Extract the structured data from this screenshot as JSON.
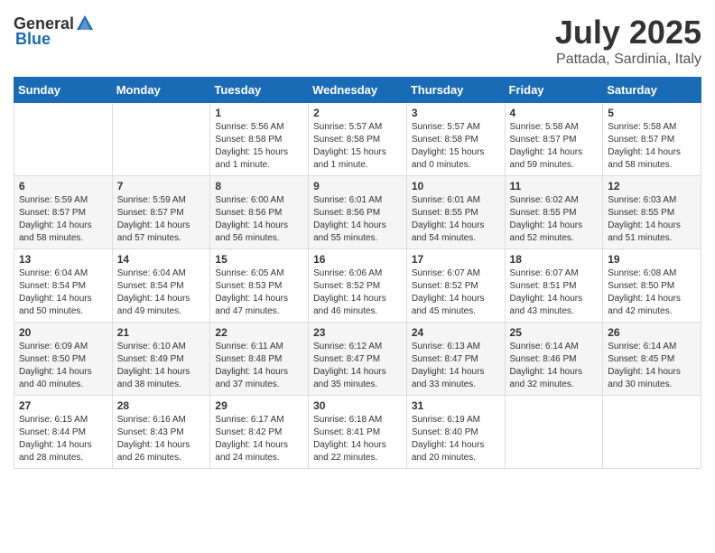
{
  "header": {
    "logo_general": "General",
    "logo_blue": "Blue",
    "title": "July 2025",
    "location": "Pattada, Sardinia, Italy"
  },
  "weekdays": [
    "Sunday",
    "Monday",
    "Tuesday",
    "Wednesday",
    "Thursday",
    "Friday",
    "Saturday"
  ],
  "weeks": [
    [
      {
        "day": "",
        "sunrise": "",
        "sunset": "",
        "daylight": ""
      },
      {
        "day": "",
        "sunrise": "",
        "sunset": "",
        "daylight": ""
      },
      {
        "day": "1",
        "sunrise": "Sunrise: 5:56 AM",
        "sunset": "Sunset: 8:58 PM",
        "daylight": "Daylight: 15 hours and 1 minute."
      },
      {
        "day": "2",
        "sunrise": "Sunrise: 5:57 AM",
        "sunset": "Sunset: 8:58 PM",
        "daylight": "Daylight: 15 hours and 1 minute."
      },
      {
        "day": "3",
        "sunrise": "Sunrise: 5:57 AM",
        "sunset": "Sunset: 8:58 PM",
        "daylight": "Daylight: 15 hours and 0 minutes."
      },
      {
        "day": "4",
        "sunrise": "Sunrise: 5:58 AM",
        "sunset": "Sunset: 8:57 PM",
        "daylight": "Daylight: 14 hours and 59 minutes."
      },
      {
        "day": "5",
        "sunrise": "Sunrise: 5:58 AM",
        "sunset": "Sunset: 8:57 PM",
        "daylight": "Daylight: 14 hours and 58 minutes."
      }
    ],
    [
      {
        "day": "6",
        "sunrise": "Sunrise: 5:59 AM",
        "sunset": "Sunset: 8:57 PM",
        "daylight": "Daylight: 14 hours and 58 minutes."
      },
      {
        "day": "7",
        "sunrise": "Sunrise: 5:59 AM",
        "sunset": "Sunset: 8:57 PM",
        "daylight": "Daylight: 14 hours and 57 minutes."
      },
      {
        "day": "8",
        "sunrise": "Sunrise: 6:00 AM",
        "sunset": "Sunset: 8:56 PM",
        "daylight": "Daylight: 14 hours and 56 minutes."
      },
      {
        "day": "9",
        "sunrise": "Sunrise: 6:01 AM",
        "sunset": "Sunset: 8:56 PM",
        "daylight": "Daylight: 14 hours and 55 minutes."
      },
      {
        "day": "10",
        "sunrise": "Sunrise: 6:01 AM",
        "sunset": "Sunset: 8:55 PM",
        "daylight": "Daylight: 14 hours and 54 minutes."
      },
      {
        "day": "11",
        "sunrise": "Sunrise: 6:02 AM",
        "sunset": "Sunset: 8:55 PM",
        "daylight": "Daylight: 14 hours and 52 minutes."
      },
      {
        "day": "12",
        "sunrise": "Sunrise: 6:03 AM",
        "sunset": "Sunset: 8:55 PM",
        "daylight": "Daylight: 14 hours and 51 minutes."
      }
    ],
    [
      {
        "day": "13",
        "sunrise": "Sunrise: 6:04 AM",
        "sunset": "Sunset: 8:54 PM",
        "daylight": "Daylight: 14 hours and 50 minutes."
      },
      {
        "day": "14",
        "sunrise": "Sunrise: 6:04 AM",
        "sunset": "Sunset: 8:54 PM",
        "daylight": "Daylight: 14 hours and 49 minutes."
      },
      {
        "day": "15",
        "sunrise": "Sunrise: 6:05 AM",
        "sunset": "Sunset: 8:53 PM",
        "daylight": "Daylight: 14 hours and 47 minutes."
      },
      {
        "day": "16",
        "sunrise": "Sunrise: 6:06 AM",
        "sunset": "Sunset: 8:52 PM",
        "daylight": "Daylight: 14 hours and 46 minutes."
      },
      {
        "day": "17",
        "sunrise": "Sunrise: 6:07 AM",
        "sunset": "Sunset: 8:52 PM",
        "daylight": "Daylight: 14 hours and 45 minutes."
      },
      {
        "day": "18",
        "sunrise": "Sunrise: 6:07 AM",
        "sunset": "Sunset: 8:51 PM",
        "daylight": "Daylight: 14 hours and 43 minutes."
      },
      {
        "day": "19",
        "sunrise": "Sunrise: 6:08 AM",
        "sunset": "Sunset: 8:50 PM",
        "daylight": "Daylight: 14 hours and 42 minutes."
      }
    ],
    [
      {
        "day": "20",
        "sunrise": "Sunrise: 6:09 AM",
        "sunset": "Sunset: 8:50 PM",
        "daylight": "Daylight: 14 hours and 40 minutes."
      },
      {
        "day": "21",
        "sunrise": "Sunrise: 6:10 AM",
        "sunset": "Sunset: 8:49 PM",
        "daylight": "Daylight: 14 hours and 38 minutes."
      },
      {
        "day": "22",
        "sunrise": "Sunrise: 6:11 AM",
        "sunset": "Sunset: 8:48 PM",
        "daylight": "Daylight: 14 hours and 37 minutes."
      },
      {
        "day": "23",
        "sunrise": "Sunrise: 6:12 AM",
        "sunset": "Sunset: 8:47 PM",
        "daylight": "Daylight: 14 hours and 35 minutes."
      },
      {
        "day": "24",
        "sunrise": "Sunrise: 6:13 AM",
        "sunset": "Sunset: 8:47 PM",
        "daylight": "Daylight: 14 hours and 33 minutes."
      },
      {
        "day": "25",
        "sunrise": "Sunrise: 6:14 AM",
        "sunset": "Sunset: 8:46 PM",
        "daylight": "Daylight: 14 hours and 32 minutes."
      },
      {
        "day": "26",
        "sunrise": "Sunrise: 6:14 AM",
        "sunset": "Sunset: 8:45 PM",
        "daylight": "Daylight: 14 hours and 30 minutes."
      }
    ],
    [
      {
        "day": "27",
        "sunrise": "Sunrise: 6:15 AM",
        "sunset": "Sunset: 8:44 PM",
        "daylight": "Daylight: 14 hours and 28 minutes."
      },
      {
        "day": "28",
        "sunrise": "Sunrise: 6:16 AM",
        "sunset": "Sunset: 8:43 PM",
        "daylight": "Daylight: 14 hours and 26 minutes."
      },
      {
        "day": "29",
        "sunrise": "Sunrise: 6:17 AM",
        "sunset": "Sunset: 8:42 PM",
        "daylight": "Daylight: 14 hours and 24 minutes."
      },
      {
        "day": "30",
        "sunrise": "Sunrise: 6:18 AM",
        "sunset": "Sunset: 8:41 PM",
        "daylight": "Daylight: 14 hours and 22 minutes."
      },
      {
        "day": "31",
        "sunrise": "Sunrise: 6:19 AM",
        "sunset": "Sunset: 8:40 PM",
        "daylight": "Daylight: 14 hours and 20 minutes."
      },
      {
        "day": "",
        "sunrise": "",
        "sunset": "",
        "daylight": ""
      },
      {
        "day": "",
        "sunrise": "",
        "sunset": "",
        "daylight": ""
      }
    ]
  ]
}
